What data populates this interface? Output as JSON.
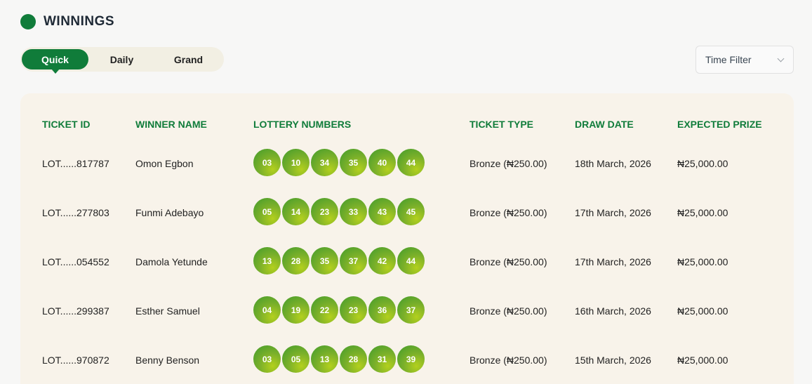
{
  "header": {
    "title": "WINNINGS"
  },
  "tabs": [
    {
      "label": "Quick",
      "active": true
    },
    {
      "label": "Daily",
      "active": false
    },
    {
      "label": "Grand",
      "active": false
    }
  ],
  "time_filter": {
    "label": "Time Filter"
  },
  "table": {
    "columns": [
      "TICKET ID",
      "WINNER NAME",
      "LOTTERY NUMBERS",
      "TICKET TYPE",
      "DRAW DATE",
      "EXPECTED PRIZE"
    ],
    "rows": [
      {
        "ticket_id": "LOT......817787",
        "winner": "Omon Egbon",
        "numbers": [
          "03",
          "10",
          "34",
          "35",
          "40",
          "44"
        ],
        "type": "Bronze (₦250.00)",
        "date": "18th March, 2026",
        "prize": "₦25,000.00"
      },
      {
        "ticket_id": "LOT......277803",
        "winner": "Funmi Adebayo",
        "numbers": [
          "05",
          "14",
          "23",
          "33",
          "43",
          "45"
        ],
        "type": "Bronze (₦250.00)",
        "date": "17th March, 2026",
        "prize": "₦25,000.00"
      },
      {
        "ticket_id": "LOT......054552",
        "winner": "Damola Yetunde",
        "numbers": [
          "13",
          "28",
          "35",
          "37",
          "42",
          "44"
        ],
        "type": "Bronze (₦250.00)",
        "date": "17th March, 2026",
        "prize": "₦25,000.00"
      },
      {
        "ticket_id": "LOT......299387",
        "winner": "Esther Samuel",
        "numbers": [
          "04",
          "19",
          "22",
          "23",
          "36",
          "37"
        ],
        "type": "Bronze (₦250.00)",
        "date": "16th March, 2026",
        "prize": "₦25,000.00"
      },
      {
        "ticket_id": "LOT......970872",
        "winner": "Benny Benson",
        "numbers": [
          "03",
          "05",
          "13",
          "28",
          "31",
          "39"
        ],
        "type": "Bronze (₦250.00)",
        "date": "15th March, 2026",
        "prize": "₦25,000.00"
      }
    ]
  },
  "colors": {
    "accent": "#107c3a",
    "panel": "#f8f3ea",
    "tab_bg": "#f2efe3"
  }
}
